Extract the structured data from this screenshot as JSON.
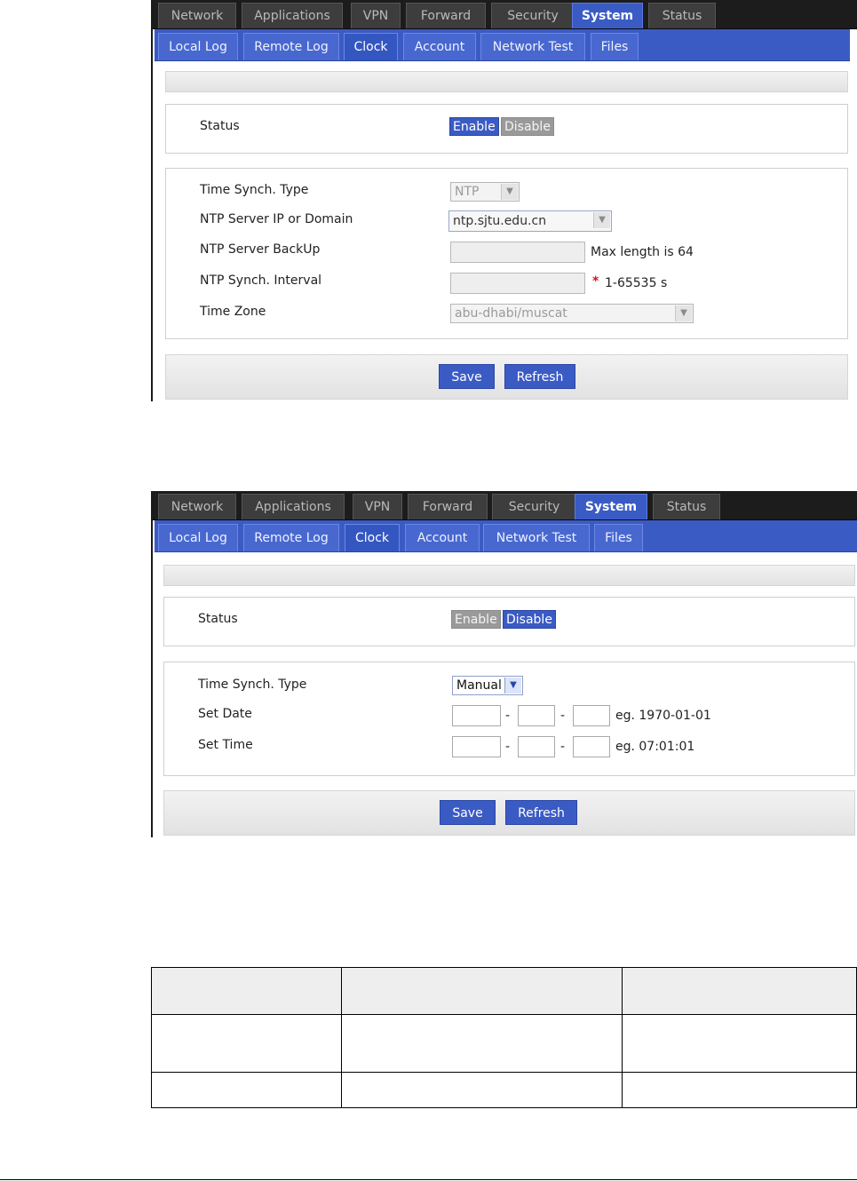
{
  "nav": {
    "tabs": [
      "Network",
      "Applications",
      "VPN",
      "Forward",
      "Security",
      "System",
      "Status"
    ],
    "active": "System"
  },
  "subnav": {
    "tabs": [
      "Local Log",
      "Remote Log",
      "Clock",
      "Account",
      "Network Test",
      "Files"
    ],
    "active": "Clock"
  },
  "ntp_panel": {
    "status_label": "Status",
    "enable_label": "Enable",
    "disable_label": "Disable",
    "status_selected": "Enable",
    "fields": {
      "synch_type_label": "Time Synch. Type",
      "synch_type_value": "NTP",
      "server_label": "NTP Server IP or Domain",
      "server_value": "ntp.sjtu.edu.cn",
      "backup_label": "NTP Server BackUp",
      "backup_value": "",
      "backup_hint": "Max length is 64",
      "interval_label": "NTP Synch. Interval",
      "interval_value": "",
      "interval_required": "*",
      "interval_hint": "1-65535 s",
      "timezone_label": "Time Zone",
      "timezone_value": "abu-dhabi/muscat"
    },
    "save_label": "Save",
    "refresh_label": "Refresh"
  },
  "manual_panel": {
    "status_label": "Status",
    "enable_label": "Enable",
    "disable_label": "Disable",
    "status_selected": "Disable",
    "fields": {
      "synch_type_label": "Time Synch. Type",
      "synch_type_value": "Manual",
      "set_date_label": "Set Date",
      "date_separator": "-",
      "date_hint": "eg. 1970-01-01",
      "set_time_label": "Set Time",
      "time_separator": "-",
      "time_hint": "eg. 07:01:01"
    },
    "save_label": "Save",
    "refresh_label": "Refresh"
  },
  "colors": {
    "accent": "#3b5bc4",
    "nav_bg": "#1c1c1c",
    "disabled_button": "#9a9a9a",
    "required_star": "#e01010"
  },
  "icons": {
    "dropdown": "chevron-down-icon"
  }
}
